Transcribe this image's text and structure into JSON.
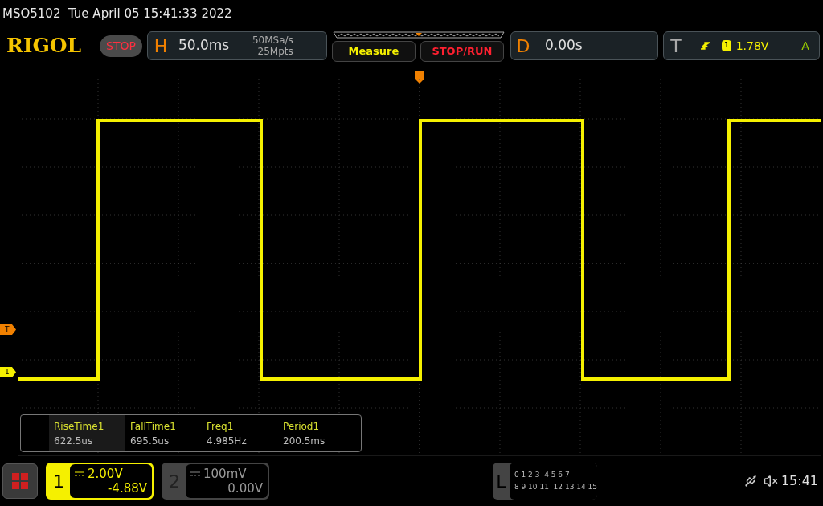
{
  "status_line": "MSO5102  Tue April 05 15:41:33 2022",
  "brand": "RIGOL",
  "run_state": "STOP",
  "horizontal": {
    "label": "H",
    "timebase": "50.0ms",
    "sample_rate": "50MSa/s",
    "memory_depth": "25Mpts"
  },
  "buttons": [
    {
      "label": "Measure",
      "kind": "measure"
    },
    {
      "label": "STOP/RUN",
      "kind": "stoprun"
    }
  ],
  "delay": {
    "label": "D",
    "value": "0.00s"
  },
  "trigger": {
    "label": "T",
    "source": "1",
    "level": "1.78V",
    "mode": "A"
  },
  "markers": [
    {
      "label": "T",
      "kind": "trigger"
    },
    {
      "label": "1",
      "kind": "channel"
    }
  ],
  "measurements": [
    {
      "name": "RiseTime1",
      "value": "622.5us",
      "selected": true
    },
    {
      "name": "FallTime1",
      "value": "695.5us",
      "selected": false
    },
    {
      "name": "Freq1",
      "value": "4.985Hz",
      "selected": false
    },
    {
      "name": "Period1",
      "value": "200.5ms",
      "selected": false
    }
  ],
  "channels": [
    {
      "number": "1",
      "scale": "2.00V",
      "offset": "-4.88V",
      "selected": true
    },
    {
      "number": "2",
      "scale": "100mV",
      "offset": "0.00V",
      "selected": false
    }
  ],
  "logic": {
    "label": "L",
    "rows": [
      "0 1 2 3  4 5 6 7",
      "8 9 10 11  12 13 14 15"
    ]
  },
  "clock": "15:41"
}
